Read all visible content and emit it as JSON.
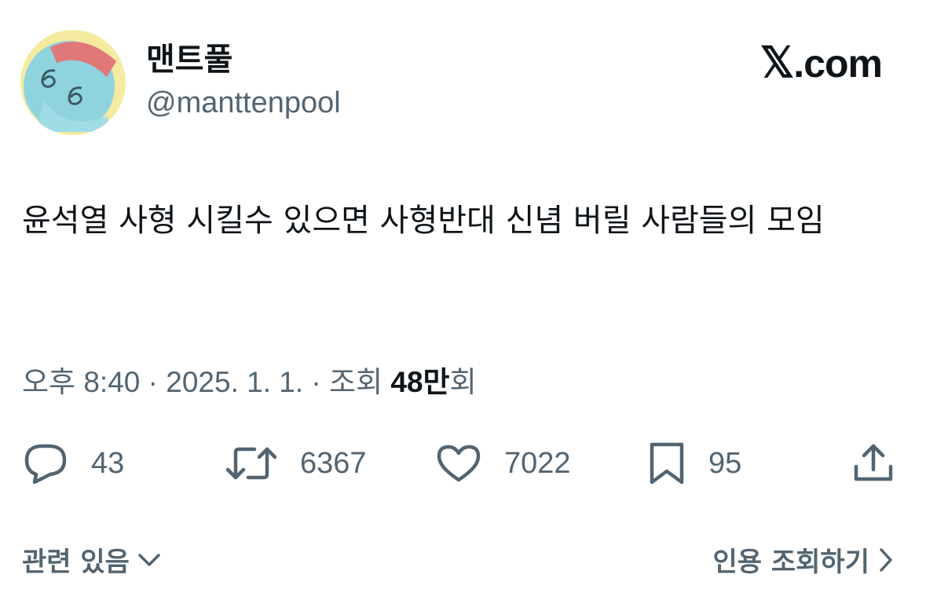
{
  "brand": {
    "glyph": "𝕏",
    "suffix": ".com"
  },
  "author": {
    "display_name": "맨트풀",
    "handle": "@manttenpool"
  },
  "tweet": {
    "text": "윤석열 사형 시킬수 있으면 사형반대 신념 버릴 사람들의 모임"
  },
  "meta": {
    "time": "오후 8:40",
    "sep1": " · ",
    "date": "2025. 1. 1.",
    "sep2": " · ",
    "views_prefix": "조회 ",
    "views_num": "48만",
    "views_suffix": "회"
  },
  "actions": {
    "replies": "43",
    "retweets": "6367",
    "likes": "7022",
    "bookmarks": "95"
  },
  "footer": {
    "related": "관련 있음",
    "quotes": "인용 조회하기"
  },
  "colors": {
    "text": "#0f1419",
    "secondary": "#536471",
    "background": "#ffffff"
  }
}
